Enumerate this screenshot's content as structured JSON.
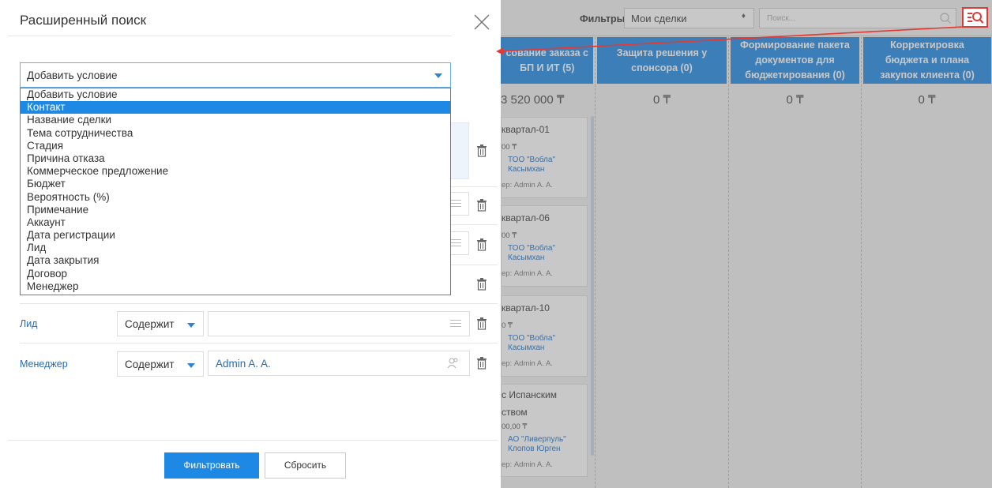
{
  "dialog": {
    "title": "Расширенный поиск",
    "condition_select": {
      "value": "Добавить условие",
      "options": [
        "Добавить условие",
        "Контакт",
        "Название сделки",
        "Тема сотрудничества",
        "Стадия",
        "Причина отказа",
        "Коммерческое предложение",
        "Бюджет",
        "Вероятность (%)",
        "Примечание",
        "Аккаунт",
        "Дата регистрации",
        "Лид",
        "Дата закрытия",
        "Договор",
        "Менеджер"
      ],
      "highlighted_option": "Контакт"
    },
    "filters": [
      {
        "label": "Лид",
        "operator": "Содержит",
        "value": ""
      },
      {
        "label": "Менеджер",
        "operator": "Содержит",
        "value": "Admin A. A."
      }
    ],
    "buttons": {
      "filter": "Фильтровать",
      "reset": "Сбросить"
    }
  },
  "board": {
    "filters_label": "Фильтры:",
    "filters_value": "Мои сделки",
    "filters_arrows": "♦",
    "search_placeholder": "Поиск...",
    "stages": [
      {
        "title": "сование заказа с\nБП И ИТ (5)",
        "sum": "3 520 000 ₸"
      },
      {
        "title": "Защита решения у\nспонсора (0)",
        "sum": "0 ₸"
      },
      {
        "title": "Формирование пакета\nдокументов для\nбюджетирования (0)",
        "sum": "0 ₸"
      },
      {
        "title": "Корректировка\nбюджета и плана\nзакупок клиента (0)",
        "sum": "0 ₸"
      }
    ],
    "cards": [
      {
        "title": "квартал-01",
        "amount": "00 ₸",
        "company": "ТОО \"Вобла\"",
        "contact": "Касымхан",
        "manager": "ер: Admin A. A."
      },
      {
        "title": "квартал-06",
        "amount": "00 ₸",
        "company": "ТОО \"Вобла\"",
        "contact": "Касымхан",
        "manager": "ер: Admin A. A."
      },
      {
        "title": "квартал-10",
        "amount": "0 ₸",
        "company": "ТОО \"Вобла\"",
        "contact": "Касымхан",
        "manager": "ер: Admin A. A."
      },
      {
        "title": "с Испанским\nством",
        "amount": "00,00 ₸",
        "company": "АО \"Ливерпуль\"",
        "contact": "Клопов Юрген",
        "manager": "ер: Admin A. A."
      }
    ]
  },
  "colors": {
    "accent": "#1e88e5",
    "highlight": "#e53935",
    "link": "#2b6cb0"
  }
}
